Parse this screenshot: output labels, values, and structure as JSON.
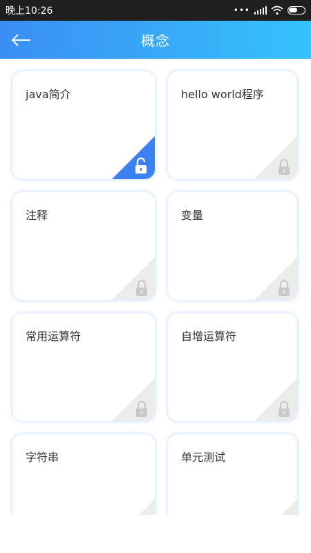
{
  "status_bar": {
    "time": "晚上10:26"
  },
  "header": {
    "title": "概念"
  },
  "cards": [
    {
      "title": "java简介",
      "state": "unlocked"
    },
    {
      "title": "hello world程序",
      "state": "locked"
    },
    {
      "title": "注释",
      "state": "locked"
    },
    {
      "title": "变量",
      "state": "locked"
    },
    {
      "title": "常用运算符",
      "state": "locked"
    },
    {
      "title": "自增运算符",
      "state": "locked"
    },
    {
      "title": "字符串",
      "state": "locked"
    },
    {
      "title": "单元测试",
      "state": "locked"
    }
  ],
  "colors": {
    "accent": "#3b82f0",
    "header_start": "#3a8ef3",
    "header_end": "#35c2fb",
    "locked_corner": "#ececec",
    "lock_icon": "#c9c9c9"
  }
}
